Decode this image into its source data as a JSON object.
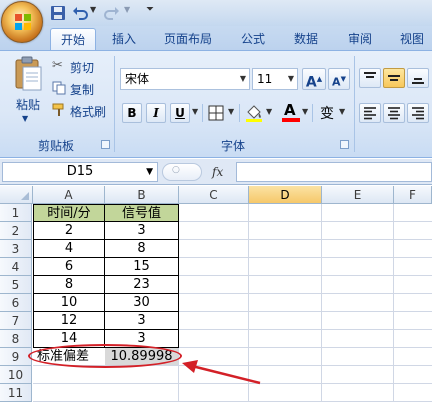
{
  "ribbon": {
    "tabs": [
      "开始",
      "插入",
      "页面布局",
      "公式",
      "数据",
      "审阅",
      "视图"
    ],
    "clipboard": {
      "paste_label": "粘贴",
      "cut_label": "剪切",
      "copy_label": "复制",
      "format_painter_label": "格式刷",
      "group_label": "剪贴板"
    },
    "font": {
      "font_name": "宋体",
      "font_size": "11",
      "bold": "B",
      "italic": "I",
      "underline": "U",
      "grow": "A",
      "shrink": "A",
      "font_color": "A",
      "phonetic": "变",
      "group_label": "字体"
    }
  },
  "formula_bar": {
    "name_box": "D15",
    "fx": "fx",
    "formula": ""
  },
  "sheet": {
    "columns": [
      "A",
      "B",
      "C",
      "D",
      "E",
      "F"
    ],
    "selected_column": "D",
    "rows": [
      "1",
      "2",
      "3",
      "4",
      "5",
      "6",
      "7",
      "8",
      "9",
      "10",
      "11"
    ],
    "header": [
      "时间/分",
      "信号值"
    ],
    "data": [
      [
        "2",
        "3"
      ],
      [
        "4",
        "8"
      ],
      [
        "6",
        "15"
      ],
      [
        "8",
        "23"
      ],
      [
        "10",
        "30"
      ],
      [
        "12",
        "3"
      ],
      [
        "14",
        "3"
      ]
    ],
    "result_label": "标准偏差",
    "result_value": "10.89998"
  },
  "colors": {
    "header_fill": "#c2d69a",
    "result_fill": "#d9d9d9",
    "annotation": "#d32027"
  },
  "icons": [
    "office-button-icon",
    "save-icon",
    "undo-icon",
    "redo-icon",
    "customize-icon",
    "paste-icon",
    "cut-icon",
    "copy-icon",
    "format-painter-icon",
    "borders-icon",
    "fill-color-icon",
    "font-color-icon",
    "align-top-icon",
    "align-middle-icon",
    "align-bottom-icon",
    "align-left-icon",
    "align-center-icon",
    "align-right-icon",
    "cancel-icon",
    "enter-icon"
  ]
}
